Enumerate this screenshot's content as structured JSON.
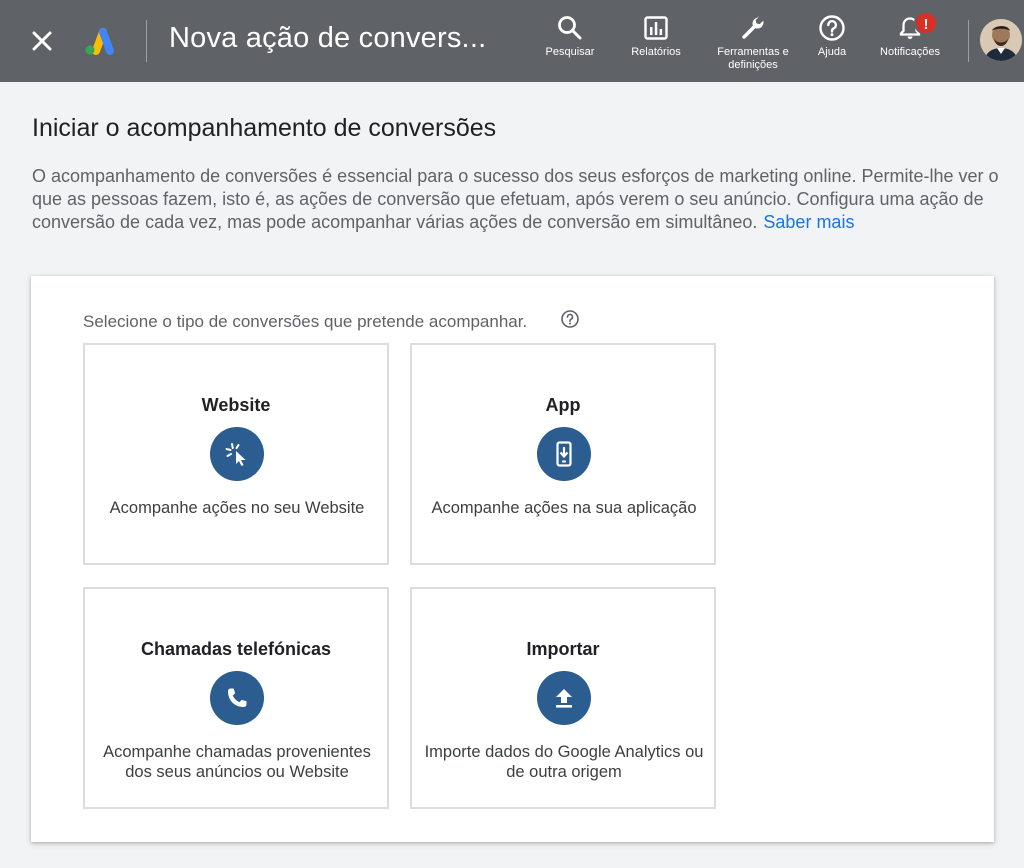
{
  "header": {
    "title": "Nova ação de convers...",
    "tools": {
      "search": "Pesquisar",
      "reports": "Relatórios",
      "tools_settings_line1": "Ferramentas e",
      "tools_settings_line2": "definições",
      "help": "Ajuda",
      "notifications": "Notificações"
    },
    "notification_badge": "!"
  },
  "main": {
    "title": "Iniciar o acompanhamento de conversões",
    "intro": "O acompanhamento de conversões é essencial para o sucesso dos seus esforços de marketing online. Permite-lhe ver o que as pessoas fazem, isto é, as ações de conversão que efetuam, após verem o seu anúncio. Configura uma ação de conversão de cada vez, mas pode acompanhar várias ações de conversão em simultâneo.",
    "learn_more": "Saber mais",
    "prompt": "Selecione o tipo de conversões que pretende acompanhar.",
    "cards": [
      {
        "title": "Website",
        "icon": "cursor-click-icon",
        "desc": "Acompanhe ações no seu Website"
      },
      {
        "title": "App",
        "icon": "phone-download-icon",
        "desc": "Acompanhe ações na sua aplicação"
      },
      {
        "title": "Chamadas telefónicas",
        "icon": "phone-call-icon",
        "desc": "Acompanhe chamadas provenientes dos seus anúncios ou Website"
      },
      {
        "title": "Importar",
        "icon": "upload-icon",
        "desc": "Importe dados do Google Analytics ou de outra origem"
      }
    ]
  },
  "colors": {
    "header_bg": "#5f6368",
    "accent_icon": "#2b5d91",
    "link": "#1a73e8",
    "badge": "#d93025"
  }
}
